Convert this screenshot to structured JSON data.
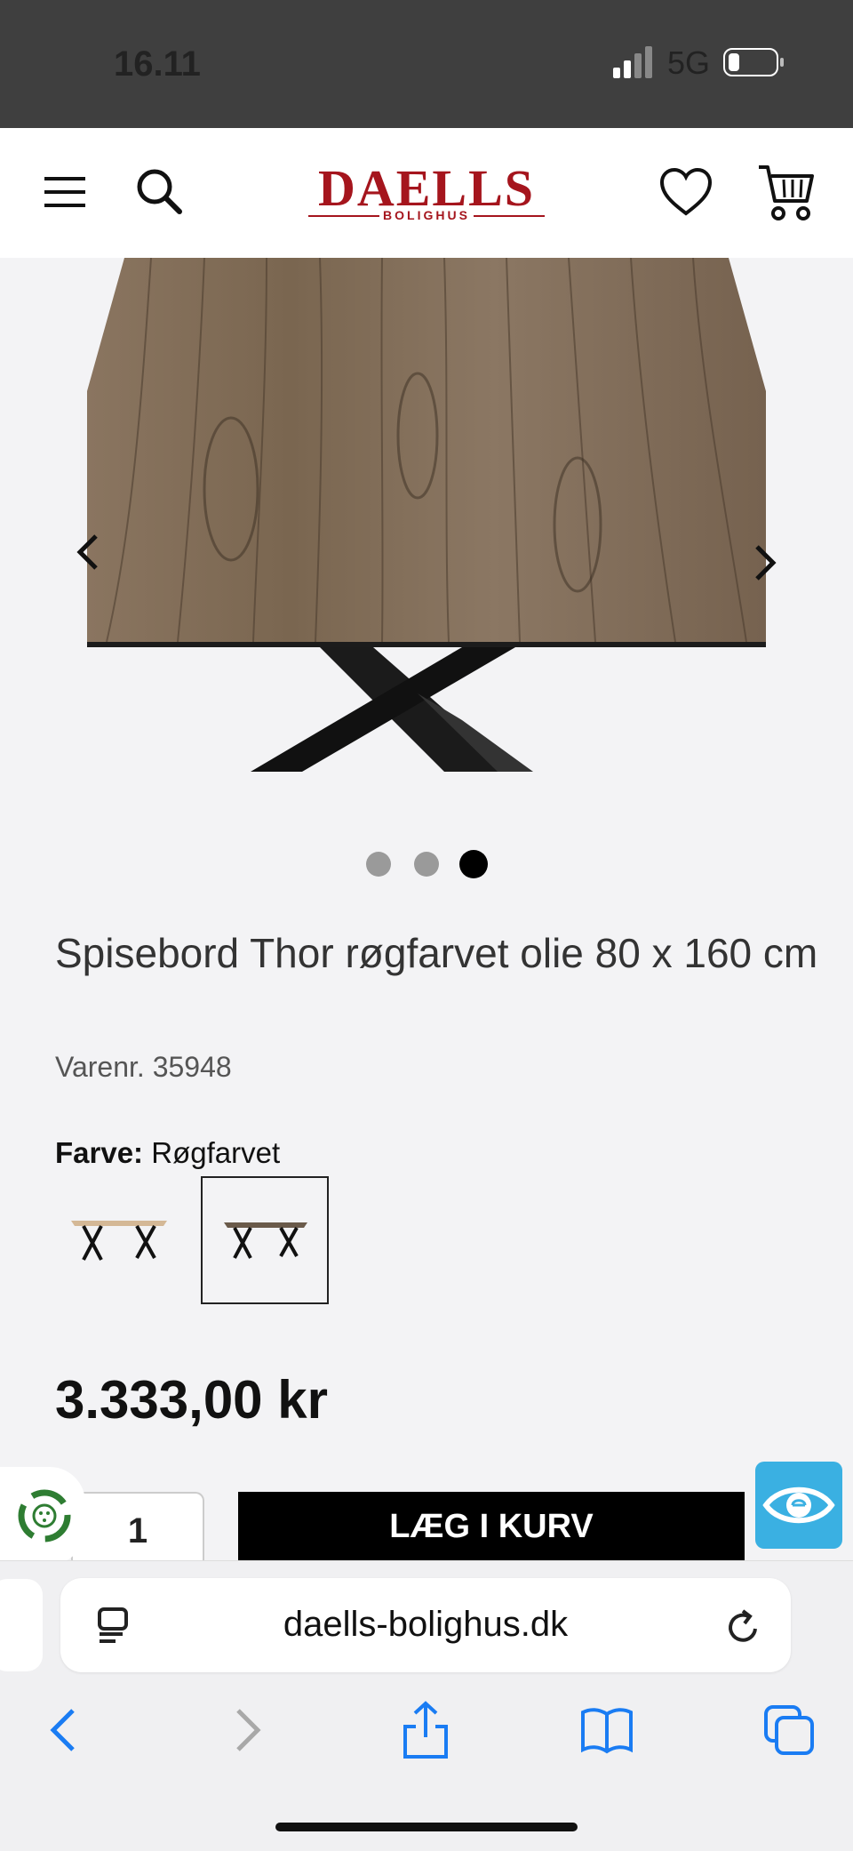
{
  "status_bar": {
    "time": "16.11",
    "network": "5G"
  },
  "header": {
    "logo_main": "DAELLS",
    "logo_sub": "BOLIGHUS"
  },
  "gallery": {
    "dot_count": 3,
    "active_dot": 3
  },
  "product": {
    "title": "Spisebord Thor røgfarvet olie 80 x 160 cm",
    "sku": "Varenr. 35948",
    "color_label": "Farve:",
    "color_value": "Røgfarvet",
    "price": "3.333,00 kr"
  },
  "cart": {
    "quantity": "1",
    "add_label": "LÆG I KURV"
  },
  "browser": {
    "url": "daells-bolighus.dk"
  },
  "colors": {
    "brand": "#a5151d",
    "accessibility_button": "#3ab0e2",
    "safari_blue": "#1a7cf3"
  }
}
